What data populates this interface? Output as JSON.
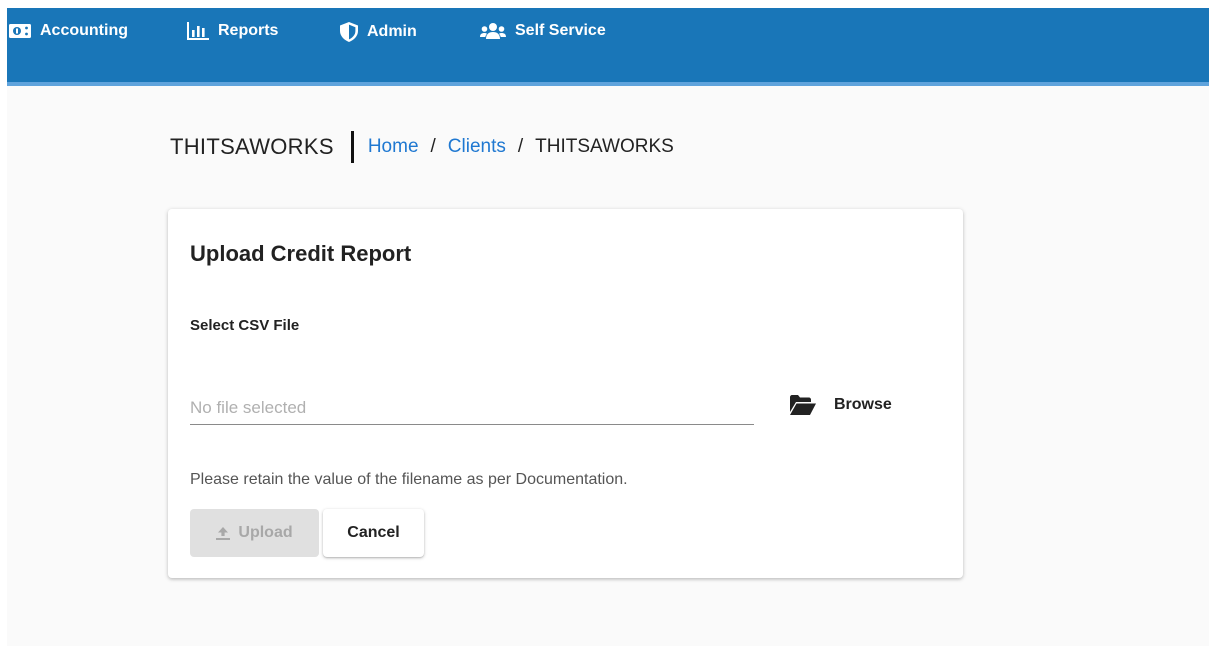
{
  "nav": {
    "items": [
      {
        "label": "Accounting",
        "icon": "money-bill-icon"
      },
      {
        "label": "Reports",
        "icon": "bar-chart-icon"
      },
      {
        "label": "Admin",
        "icon": "shield-icon"
      },
      {
        "label": "Self Service",
        "icon": "users-icon"
      }
    ]
  },
  "breadcrumb": {
    "page_title": "THITSAWORKS",
    "home": "Home",
    "separator": "/",
    "clients": "Clients",
    "current": "THITSAWORKS"
  },
  "card": {
    "title": "Upload Credit Report",
    "field_label": "Select CSV File",
    "file_placeholder": "No file selected",
    "file_value": "",
    "browse_label": "Browse",
    "browse_icon": "folder-open-icon",
    "hint": "Please retain the value of the filename as per Documentation.",
    "upload_label": "Upload",
    "upload_icon": "upload-icon",
    "cancel_label": "Cancel"
  },
  "colors": {
    "topbar": "#1976b8",
    "topbar_underline": "#5fa3dc",
    "link": "#1f78d1",
    "disabled_button": "#e0e0e0"
  }
}
